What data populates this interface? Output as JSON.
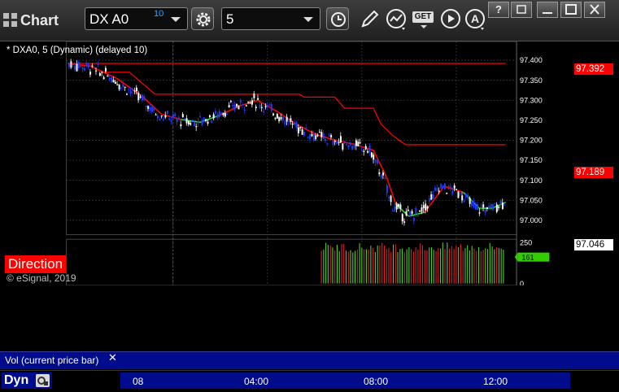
{
  "app": {
    "title": "Chart"
  },
  "toolbar": {
    "symbol": "DX A0",
    "symbol_superscript": "10",
    "interval": "5",
    "tools": [
      {
        "icon": "gear-icon"
      },
      {
        "icon": "clock-icon"
      },
      {
        "icon": "pencil-icon"
      },
      {
        "icon": "studies-icon"
      },
      {
        "icon": "get-icon",
        "text": "GET"
      },
      {
        "icon": "play-icon"
      },
      {
        "icon": "alert-icon"
      }
    ]
  },
  "window_controls": {
    "help": "?",
    "restore": "",
    "minimize": "",
    "maximize": "",
    "close": ""
  },
  "chart": {
    "series_label": "* DXA0, 5 (Dynamic) (delayed 10)",
    "direction_label": "Direction",
    "copyright": "© eSignal, 2019",
    "price_axis": {
      "ticks": [
        "97.400",
        "97.350",
        "97.300",
        "97.250",
        "97.200",
        "97.150",
        "97.100",
        "97.050",
        "97.000"
      ],
      "min": 96.975,
      "max": 97.41
    },
    "price_tags": [
      {
        "value": "97.392",
        "price": 97.392,
        "bg": "#ff0000",
        "fg": "#ffffff"
      },
      {
        "value": "97.189",
        "price": 97.189,
        "bg": "#ff0000",
        "fg": "#ffffff"
      },
      {
        "value": "97.046",
        "price": 97.046,
        "bg": "#ffffff",
        "fg": "#000000"
      }
    ],
    "colors": {
      "up_bar": "#ffffff",
      "down_bar": "#1f3cff",
      "ma_down": "#ff0000",
      "ma_up": "#22dd22",
      "stop_line": "#ff0000",
      "grid": "#444444"
    }
  },
  "volume": {
    "label": "Vol (current price bar)",
    "axis_ticks": [
      "250",
      "0"
    ],
    "current_tag": "161",
    "current_tag_color": "#33cc00"
  },
  "time_axis": {
    "labels": [
      "08",
      "04:00",
      "08:00",
      "12:00"
    ]
  },
  "bottom": {
    "mode_label": "Dyn"
  }
}
